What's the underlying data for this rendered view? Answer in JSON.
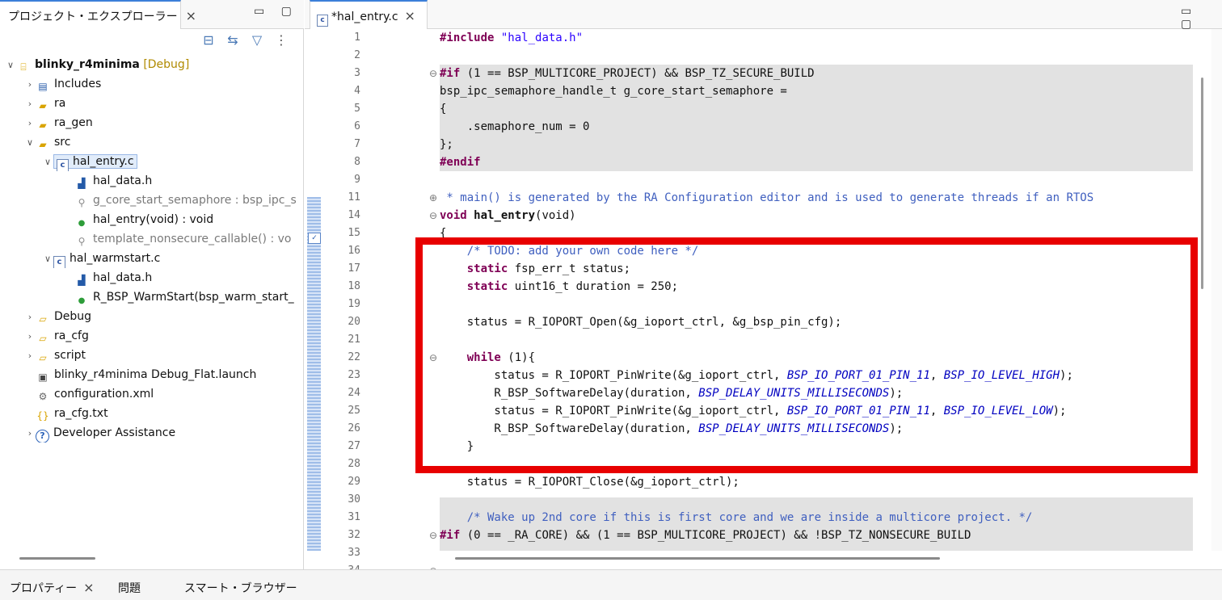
{
  "explorer": {
    "tab_title": "プロジェクト・エクスプローラー",
    "close_icon": "×",
    "window_buttons": "▭ ▢",
    "toolbar": [
      "collapse-all-icon",
      "link-with-editor-icon",
      "filter-icon",
      "view-menu-icon"
    ],
    "tree": [
      {
        "label": "blinky_r4minima",
        "suffix": "[Debug]",
        "icon": "project-icon",
        "twisty": "open",
        "bold": true
      },
      {
        "label": "Includes",
        "icon": "includes-icon",
        "twisty": "closed"
      },
      {
        "label": "ra",
        "icon": "folder-icon",
        "twisty": "closed"
      },
      {
        "label": "ra_gen",
        "icon": "folder-icon",
        "twisty": "closed"
      },
      {
        "label": "src",
        "icon": "folder-icon",
        "twisty": "open"
      },
      {
        "label": "hal_entry.c",
        "icon": "c-file-icon",
        "twisty": "open",
        "selected": true
      },
      {
        "label": "hal_data.h",
        "icon": "include-header-icon"
      },
      {
        "label": "g_core_start_semaphore : bsp_ipc_s",
        "icon": "variable-icon",
        "grey": true
      },
      {
        "label": "hal_entry(void) : void",
        "icon": "function-icon"
      },
      {
        "label": "template_nonsecure_callable() : vo",
        "icon": "variable-icon",
        "grey": true
      },
      {
        "label": "hal_warmstart.c",
        "icon": "c-file-icon",
        "twisty": "open"
      },
      {
        "label": "hal_data.h",
        "icon": "include-header-icon"
      },
      {
        "label": "R_BSP_WarmStart(bsp_warm_start_",
        "icon": "function-icon"
      },
      {
        "label": "Debug",
        "icon": "folder-icon",
        "twisty": "closed"
      },
      {
        "label": "ra_cfg",
        "icon": "folder-icon",
        "twisty": "closed"
      },
      {
        "label": "script",
        "icon": "folder-icon",
        "twisty": "closed"
      },
      {
        "label": "blinky_r4minima Debug_Flat.launch",
        "icon": "launch-file-icon"
      },
      {
        "label": "configuration.xml",
        "icon": "configuration-gear-icon"
      },
      {
        "label": "ra_cfg.txt",
        "icon": "text-file-icon"
      },
      {
        "label": "Developer Assistance",
        "icon": "help-icon",
        "twisty": "closed"
      }
    ]
  },
  "editor": {
    "tab_title": "*hal_entry.c",
    "tab_icon_label": "c",
    "close_icon": "×",
    "window_buttons": "▭ ▢",
    "line_numbers": [
      "1",
      "2",
      "3",
      "4",
      "5",
      "6",
      "7",
      "8",
      "9",
      "11",
      "14",
      "15",
      "16",
      "17",
      "18",
      "19",
      "20",
      "21",
      "22",
      "23",
      "24",
      "25",
      "26",
      "27",
      "28",
      "29",
      "30",
      "31",
      "32",
      "33",
      "34"
    ],
    "code_lines": [
      "#include \"hal_data.h\"",
      "",
      "#if (1 == BSP_MULTICORE_PROJECT) && BSP_TZ_SECURE_BUILD",
      "bsp_ipc_semaphore_handle_t g_core_start_semaphore =",
      "{",
      "    .semaphore_num = 0",
      "};",
      "#endif",
      "",
      " * main() is generated by the RA Configuration editor and is used to generate threads if an RTOS",
      "void hal_entry(void)",
      "{",
      "    /* TODO: add your own code here */",
      "    static fsp_err_t status;",
      "    static uint16_t duration = 250;",
      "",
      "    status = R_IOPORT_Open(&g_ioport_ctrl, &g_bsp_pin_cfg);",
      "",
      "    while (1){",
      "        status = R_IOPORT_PinWrite(&g_ioport_ctrl, BSP_IO_PORT_01_PIN_11, BSP_IO_LEVEL_HIGH);",
      "        R_BSP_SoftwareDelay(duration, BSP_DELAY_UNITS_MILLISECONDS);",
      "        status = R_IOPORT_PinWrite(&g_ioport_ctrl, BSP_IO_PORT_01_PIN_11, BSP_IO_LEVEL_LOW);",
      "        R_BSP_SoftwareDelay(duration, BSP_DELAY_UNITS_MILLISECONDS);",
      "    }",
      "",
      "    status = R_IOPORT_Close(&g_ioport_ctrl);",
      "",
      "    /* Wake up 2nd core if this is first core and we are inside a multicore project. */",
      "#if (0 == _RA_CORE) && (1 == BSP_MULTICORE_PROJECT) && !BSP_TZ_NONSECURE_BUILD",
      "",
      "#if BSP_TZ_SECURE_BUILD"
    ],
    "fold_markers": [
      "⊖",
      "⊕",
      "⊖",
      "⊖",
      "⊖",
      "⊖"
    ],
    "task_marker": "✓"
  },
  "bottom_tabs": [
    {
      "label": "プロパティー",
      "closable": true
    },
    {
      "label": "問題",
      "closable": false
    },
    {
      "label": "スマート・ブラウザー",
      "closable": false
    }
  ],
  "colors": {
    "keyword": "#7f0055",
    "string": "#2a00ff",
    "comment": "#3f5fbf",
    "constant": "#0000c0",
    "highlight_box": "#e80000",
    "inactive_code_bg": "#e2e2e2"
  }
}
